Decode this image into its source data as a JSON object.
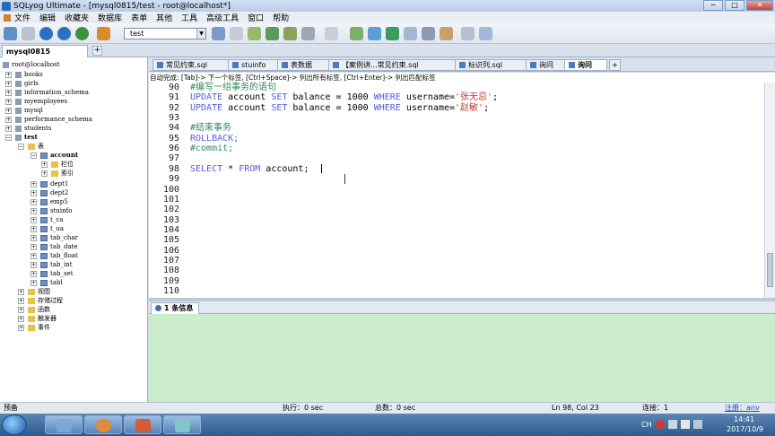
{
  "window": {
    "title": "SQLyog Ultimate - [mysql0815/test - root@localhost*]"
  },
  "window_buttons": {
    "minimize": "─",
    "maximize": "□",
    "close": "✕"
  },
  "menu": [
    "文件",
    "编辑",
    "收藏夹",
    "数据库",
    "表单",
    "其他",
    "工具",
    "高级工具",
    "窗口",
    "帮助"
  ],
  "toolbar": {
    "database_select": "test",
    "dropdown_arrow": "▼"
  },
  "connection_tab": {
    "label": "mysql0815",
    "add": "+"
  },
  "object_tree": {
    "root": "root@localhost",
    "databases": [
      "books",
      "girls",
      "information_schema",
      "myemployees",
      "mysql",
      "performance_schema",
      "students"
    ],
    "open_db": "test",
    "tables_folder": "表",
    "open_table": "account",
    "table_children": [
      "栏位",
      "索引"
    ],
    "tables": [
      "dept1",
      "dept2",
      "emp5",
      "stuinfo",
      "t_ca",
      "t_ua",
      "tab_char",
      "tab_date",
      "tab_float",
      "tab_int",
      "tab_set",
      "tabl"
    ],
    "folders": [
      "视图",
      "存储过程",
      "函数",
      "触发器",
      "事件"
    ]
  },
  "query_tabs": [
    "常见约束.sql",
    "stuinfo",
    "表数据",
    "【案例讲...常见约束.sql",
    "标识列.sql",
    "询问",
    "询问"
  ],
  "query_tab_add": "+",
  "autocomplete_hint": "自动完成: [Tab]-> 下一个标签, [Ctrl+Space]-> 列出所有标签, [Ctrl+Enter]-> 列出匹配标签",
  "editor": {
    "line_numbers": [
      "90",
      "91",
      "92",
      "93",
      "94",
      "95",
      "96",
      "97",
      "98",
      "99",
      "100",
      "101",
      "102",
      "103",
      "104",
      "105",
      "106",
      "107",
      "108",
      "109",
      "110"
    ],
    "code": {
      "l90": "#编写一组事务的语句",
      "l91_kw1": "UPDATE",
      "l91_t1": " account ",
      "l91_kw2": "SET",
      "l91_t2": " balance = 1000 ",
      "l91_kw3": "WHERE",
      "l91_t3": " username=",
      "l91_str": "'张无忌'",
      "l91_end": ";",
      "l92_kw1": "UPDATE",
      "l92_t1": " account ",
      "l92_kw2": "SET",
      "l92_t2": " balance = 1000 ",
      "l92_kw3": "WHERE",
      "l92_t3": " username=",
      "l92_str": "'赵敏'",
      "l92_end": ";",
      "l94": "#结束事务",
      "l95": "ROLLBACK;",
      "l96": "#commit;",
      "l98_kw1": "SELECT",
      "l98_t1": " * ",
      "l98_kw2": "FROM",
      "l98_t2": " account;"
    }
  },
  "results": {
    "tab_label": "1 条信息"
  },
  "statusbar": {
    "left": "预备",
    "exec_time": "执行：0 sec",
    "total_time": "总数：0 sec",
    "cursor": "Ln 98, Col 23",
    "connections": "连接：1",
    "register": "注册：anv"
  },
  "taskbar": {
    "lang": "CH",
    "clock_time": "14:41",
    "clock_date": "2017/10/9"
  },
  "colors": {
    "keyword": "#5a5adf",
    "comment": "#2e8b57",
    "string": "#c0392b",
    "results_bg": "#cbeccd"
  }
}
